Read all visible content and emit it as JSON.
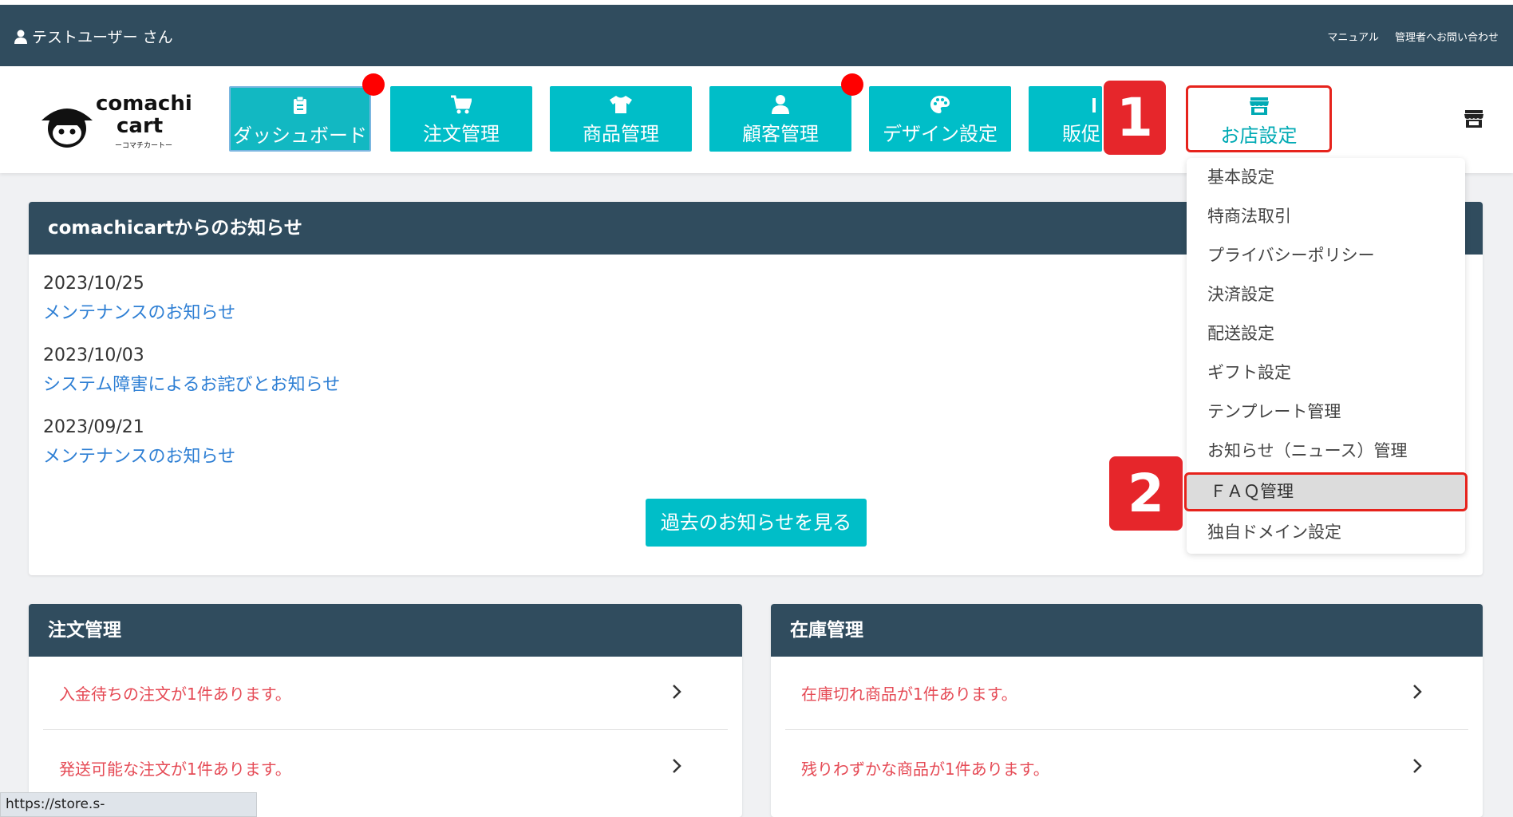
{
  "header": {
    "user_name": "テストユーザー さん",
    "links": [
      "マニュアル",
      "管理者へお問い合わせ"
    ]
  },
  "logo": {
    "line1": "comachi",
    "line2": "cart",
    "sub": "ーコマチカートー"
  },
  "nav": [
    {
      "label": "ダッシュボード",
      "icon": "clipboard-icon",
      "badge": true
    },
    {
      "label": "注文管理",
      "icon": "cart-icon",
      "badge": false
    },
    {
      "label": "商品管理",
      "icon": "tshirt-icon",
      "badge": false
    },
    {
      "label": "顧客管理",
      "icon": "user-icon",
      "badge": true
    },
    {
      "label": "デザイン設定",
      "icon": "palette-icon",
      "badge": false
    },
    {
      "label": "販促",
      "icon": "chart-icon",
      "badge": false
    },
    {
      "label": "お店設定",
      "icon": "store-icon",
      "badge": false
    }
  ],
  "markers": [
    "1",
    "2"
  ],
  "dropdown": {
    "items": [
      "基本設定",
      "特商法取引",
      "プライバシーポリシー",
      "決済設定",
      "配送設定",
      "ギフト設定",
      "テンプレート管理",
      "お知らせ（ニュース）管理",
      "ＦＡＱ管理",
      "独自ドメイン設定"
    ],
    "highlighted_index": 8
  },
  "notices": {
    "title": "comachicartからのお知らせ",
    "items": [
      {
        "date": "2023/10/25",
        "title": "メンテナンスのお知らせ"
      },
      {
        "date": "2023/10/03",
        "title": "システム障害によるお詫びとお知らせ"
      },
      {
        "date": "2023/09/21",
        "title": "メンテナンスのお知らせ"
      }
    ],
    "past_button": "過去のお知らせを見る"
  },
  "orders": {
    "title": "注文管理",
    "rows": [
      "入金待ちの注文が1件あります。",
      "発送可能な注文が1件あります。"
    ]
  },
  "stock": {
    "title": "在庫管理",
    "rows": [
      "在庫切れ商品が1件あります。",
      "残りわずかな商品が1件あります。"
    ]
  },
  "colors": {
    "header_bg": "#304c5e",
    "accent": "#00bec8",
    "alert_text": "#e54a55",
    "link": "#2e7fd4",
    "marker": "#e6262b"
  },
  "status_url": "https://store.s-flyingfox.com/store/faq"
}
